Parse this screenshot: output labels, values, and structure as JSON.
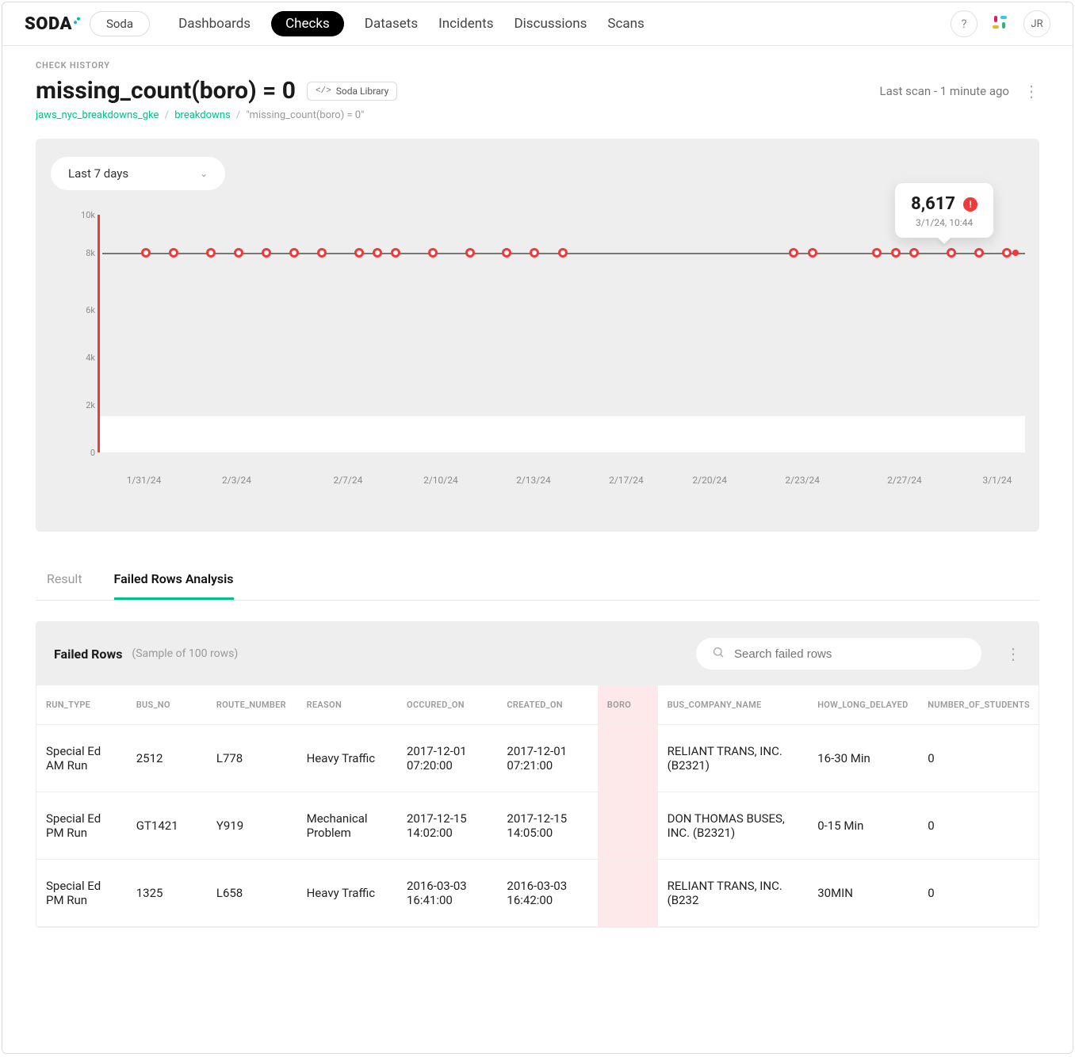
{
  "brand": "SODA",
  "env_label": "Soda",
  "nav": [
    "Dashboards",
    "Checks",
    "Datasets",
    "Incidents",
    "Discussions",
    "Scans"
  ],
  "nav_active_index": 1,
  "avatar_initials": "JR",
  "eyebrow": "CHECK HISTORY",
  "check_title": "missing_count(boro) = 0",
  "lib_badge_prefix": "</>",
  "lib_badge": "Soda Library",
  "last_scan_text": "Last scan - 1 minute ago",
  "breadcrumb": {
    "a": "jaws_nyc_breakdowns_gke",
    "b": "breakdowns",
    "c": "\"missing_count(boro) = 0\""
  },
  "time_range": "Last 7 days",
  "chart_data": {
    "type": "scatter",
    "title": "",
    "xlabel": "",
    "ylabel": "",
    "ylim": [
      0,
      10000
    ],
    "yticks": [
      0,
      2000,
      4000,
      6000,
      8000,
      10000
    ],
    "ytick_labels": [
      "0",
      "2k",
      "4k",
      "6k",
      "8k",
      "10k"
    ],
    "x_labels": [
      "1/31/24",
      "2/3/24",
      "2/7/24",
      "2/10/24",
      "2/13/24",
      "2/17/24",
      "2/20/24",
      "2/23/24",
      "2/27/24",
      "3/1/24"
    ],
    "series": [
      {
        "name": "missing_count(boro)",
        "color": "#f03a3a",
        "points_x_pct": [
          5,
          8,
          12,
          15,
          18,
          21,
          24,
          28,
          30,
          32,
          36,
          40,
          44,
          47,
          50,
          75,
          77,
          84,
          86,
          88,
          92,
          95,
          98
        ],
        "value": 8617
      }
    ],
    "tooltip": {
      "value_text": "8,617",
      "timestamp": "3/1/24, 10:44"
    }
  },
  "tabs": [
    "Result",
    "Failed Rows Analysis"
  ],
  "active_tab_index": 1,
  "failed_rows": {
    "heading": "Failed Rows",
    "subtext": "(Sample of 100 rows)",
    "search_placeholder": "Search failed rows",
    "columns": [
      "RUN_TYPE",
      "BUS_NO",
      "ROUTE_NUMBER",
      "REASON",
      "OCCURED_ON",
      "CREATED_ON",
      "BORO",
      "BUS_COMPANY_NAME",
      "HOW_LONG_DELAYED",
      "NUMBER_OF_STUDENTS"
    ],
    "rows": [
      {
        "RUN_TYPE": "Special Ed AM Run",
        "BUS_NO": "2512",
        "ROUTE_NUMBER": "L778",
        "REASON": "Heavy Traffic",
        "OCCURED_ON": "2017-12-01 07:20:00",
        "CREATED_ON": "2017-12-01 07:21:00",
        "BORO": "",
        "BUS_COMPANY_NAME": "RELIANT TRANS, INC. (B2321)",
        "HOW_LONG_DELAYED": "16-30 Min",
        "NUMBER_OF_STUDENTS": "0"
      },
      {
        "RUN_TYPE": "Special Ed PM Run",
        "BUS_NO": "GT1421",
        "ROUTE_NUMBER": "Y919",
        "REASON": "Mechanical Problem",
        "OCCURED_ON": "2017-12-15 14:02:00",
        "CREATED_ON": "2017-12-15 14:05:00",
        "BORO": "",
        "BUS_COMPANY_NAME": "DON THOMAS BUSES, INC. (B2321)",
        "HOW_LONG_DELAYED": "0-15 Min",
        "NUMBER_OF_STUDENTS": "0"
      },
      {
        "RUN_TYPE": "Special Ed PM Run",
        "BUS_NO": "1325",
        "ROUTE_NUMBER": "L658",
        "REASON": "Heavy Traffic",
        "OCCURED_ON": "2016-03-03 16:41:00",
        "CREATED_ON": "2016-03-03 16:42:00",
        "BORO": "",
        "BUS_COMPANY_NAME": "RELIANT TRANS, INC. (B232",
        "HOW_LONG_DELAYED": "30MIN",
        "NUMBER_OF_STUDENTS": "0"
      }
    ]
  }
}
